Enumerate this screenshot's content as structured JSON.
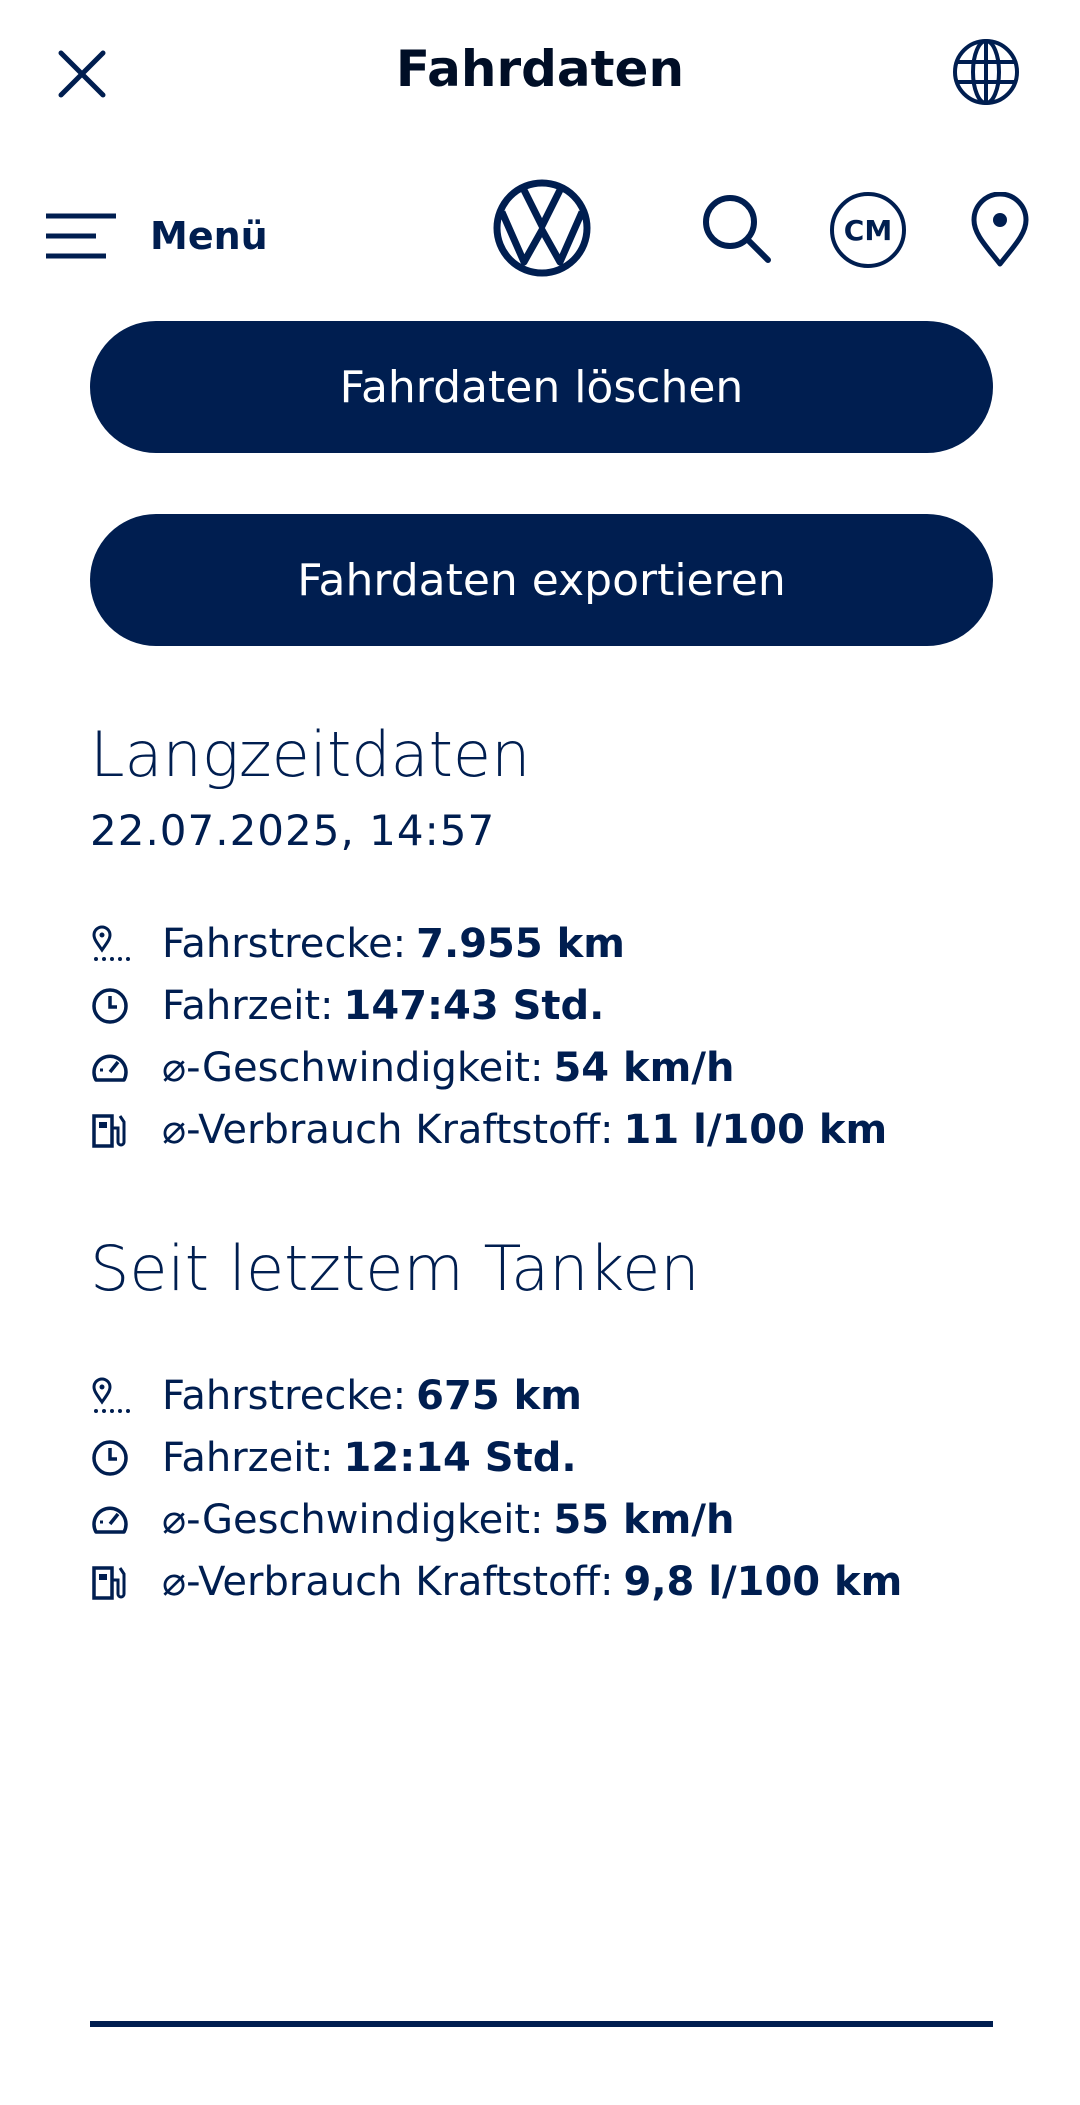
{
  "header": {
    "title": "Fahrdaten"
  },
  "nav": {
    "menu_label": "Menü",
    "cm_label": "CM"
  },
  "actions": {
    "delete_label": "Fahrdaten löschen",
    "export_label": "Fahrdaten exportieren"
  },
  "longterm": {
    "title": "Langzeitdaten",
    "date": "22.07.2025, 14:57",
    "stats": [
      {
        "icon": "route-pin-icon",
        "label": "Fahrstrecke:",
        "value": "7.955 km"
      },
      {
        "icon": "clock-icon",
        "label": "Fahrzeit:",
        "value": "147:43 Std."
      },
      {
        "icon": "speedometer-icon",
        "label": "⌀-Geschwindigkeit:",
        "value": "54 km/h"
      },
      {
        "icon": "fuel-pump-icon",
        "label": "⌀-Verbrauch Kraftstoff:",
        "value": "11 l/100 km"
      }
    ]
  },
  "since_refuel": {
    "title": "Seit letztem Tanken",
    "stats": [
      {
        "icon": "route-pin-icon",
        "label": "Fahrstrecke:",
        "value": "675 km"
      },
      {
        "icon": "clock-icon",
        "label": "Fahrzeit:",
        "value": "12:14 Std."
      },
      {
        "icon": "speedometer-icon",
        "label": "⌀-Geschwindigkeit:",
        "value": "55 km/h"
      },
      {
        "icon": "fuel-pump-icon",
        "label": "⌀-Verbrauch Kraftstoff:",
        "value": "9,8 l/100 km"
      }
    ]
  },
  "colors": {
    "brand": "#001e50",
    "background": "#ffffff"
  }
}
